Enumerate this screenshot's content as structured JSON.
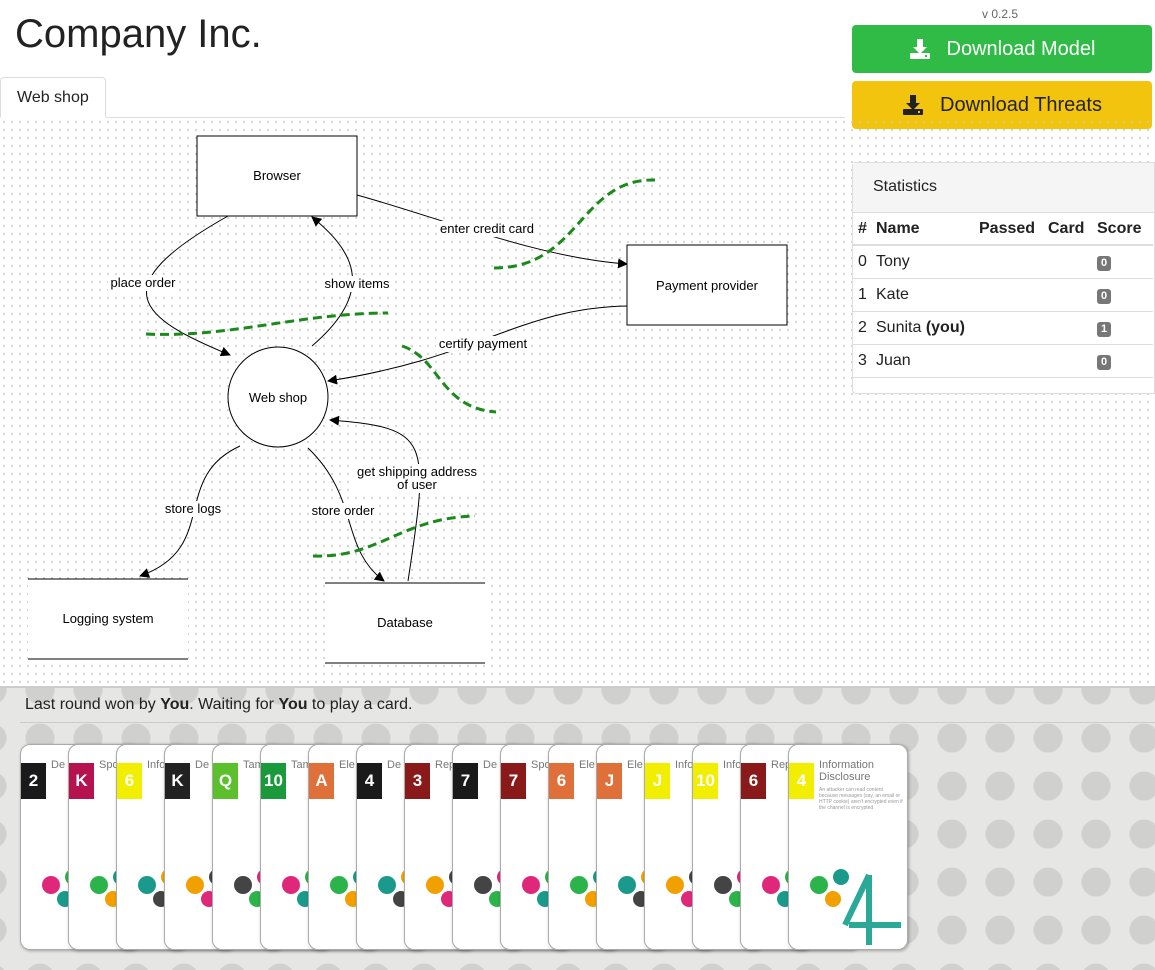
{
  "header": {
    "title": "Company Inc.",
    "version": "v 0.2.5",
    "download_model_label": "Download Model",
    "download_threats_label": "Download Threats"
  },
  "tabs": [
    {
      "label": "Web shop",
      "active": true
    }
  ],
  "diagram": {
    "nodes": {
      "browser": "Browser",
      "payment_provider": "Payment provider",
      "web_shop": "Web shop",
      "logging_system": "Logging system",
      "database": "Database"
    },
    "flows": {
      "enter_credit_card": "enter credit card",
      "place_order": "place order",
      "show_items": "show items",
      "certify_payment": "certify payment",
      "store_logs": "store logs",
      "store_order": "store order",
      "get_shipping_line1": "get shipping address",
      "get_shipping_line2": "of user"
    },
    "trust_boundary_color": "#1a8a1a"
  },
  "statistics": {
    "title": "Statistics",
    "columns": [
      "#",
      "Name",
      "Passed",
      "Card",
      "Score"
    ],
    "rows": [
      {
        "index": "0",
        "name": "Tony",
        "you": "",
        "passed": "",
        "card": "",
        "score": "0"
      },
      {
        "index": "1",
        "name": "Kate",
        "you": "",
        "passed": "",
        "card": "",
        "score": "0"
      },
      {
        "index": "2",
        "name": "Sunita",
        "you": "(you)",
        "passed": "",
        "card": "",
        "score": "1"
      },
      {
        "index": "3",
        "name": "Juan",
        "you": "",
        "passed": "",
        "card": "",
        "score": "0"
      }
    ]
  },
  "status": {
    "prefix": "Last round won by ",
    "winner": "You",
    "middle": ". Waiting for ",
    "waiting_for": "You",
    "suffix": " to play a card."
  },
  "hand": {
    "cards": [
      {
        "rank": "2",
        "title": "De Ser",
        "color": "#1a1a1a"
      },
      {
        "rank": "K",
        "title": "Spo",
        "color": "#b5124f"
      },
      {
        "rank": "6",
        "title": "Info Discl",
        "color": "#f2ee00"
      },
      {
        "rank": "K",
        "title": "De Ser",
        "color": "#222222"
      },
      {
        "rank": "Q",
        "title": "Tam",
        "color": "#5cc02c"
      },
      {
        "rank": "10",
        "title": "Tam",
        "color": "#1a9a3a"
      },
      {
        "rank": "A",
        "title": "Ele of P",
        "color": "#e0703a"
      },
      {
        "rank": "4",
        "title": "De Ser",
        "color": "#1a1a1a"
      },
      {
        "rank": "3",
        "title": "Rep",
        "color": "#8a1a1a"
      },
      {
        "rank": "7",
        "title": "De Ser",
        "color": "#1a1a1a"
      },
      {
        "rank": "7",
        "title": "Spo",
        "color": "#8a1a1a"
      },
      {
        "rank": "6",
        "title": "Ele of P",
        "color": "#e0703a"
      },
      {
        "rank": "J",
        "title": "Ele of P",
        "color": "#e0703a"
      },
      {
        "rank": "J",
        "title": "Info Discl",
        "color": "#f2ee00"
      },
      {
        "rank": "10",
        "title": "Info Discl",
        "color": "#f2ee00"
      },
      {
        "rank": "6",
        "title": "Rep",
        "color": "#8a1a1a"
      },
      {
        "rank": "4",
        "title": "Information Disclosure",
        "color": "#f2ee00",
        "text": "An attacker can read content because messages (say, an email or HTTP cookie) aren't encrypted even if the channel is encrypted"
      }
    ]
  }
}
